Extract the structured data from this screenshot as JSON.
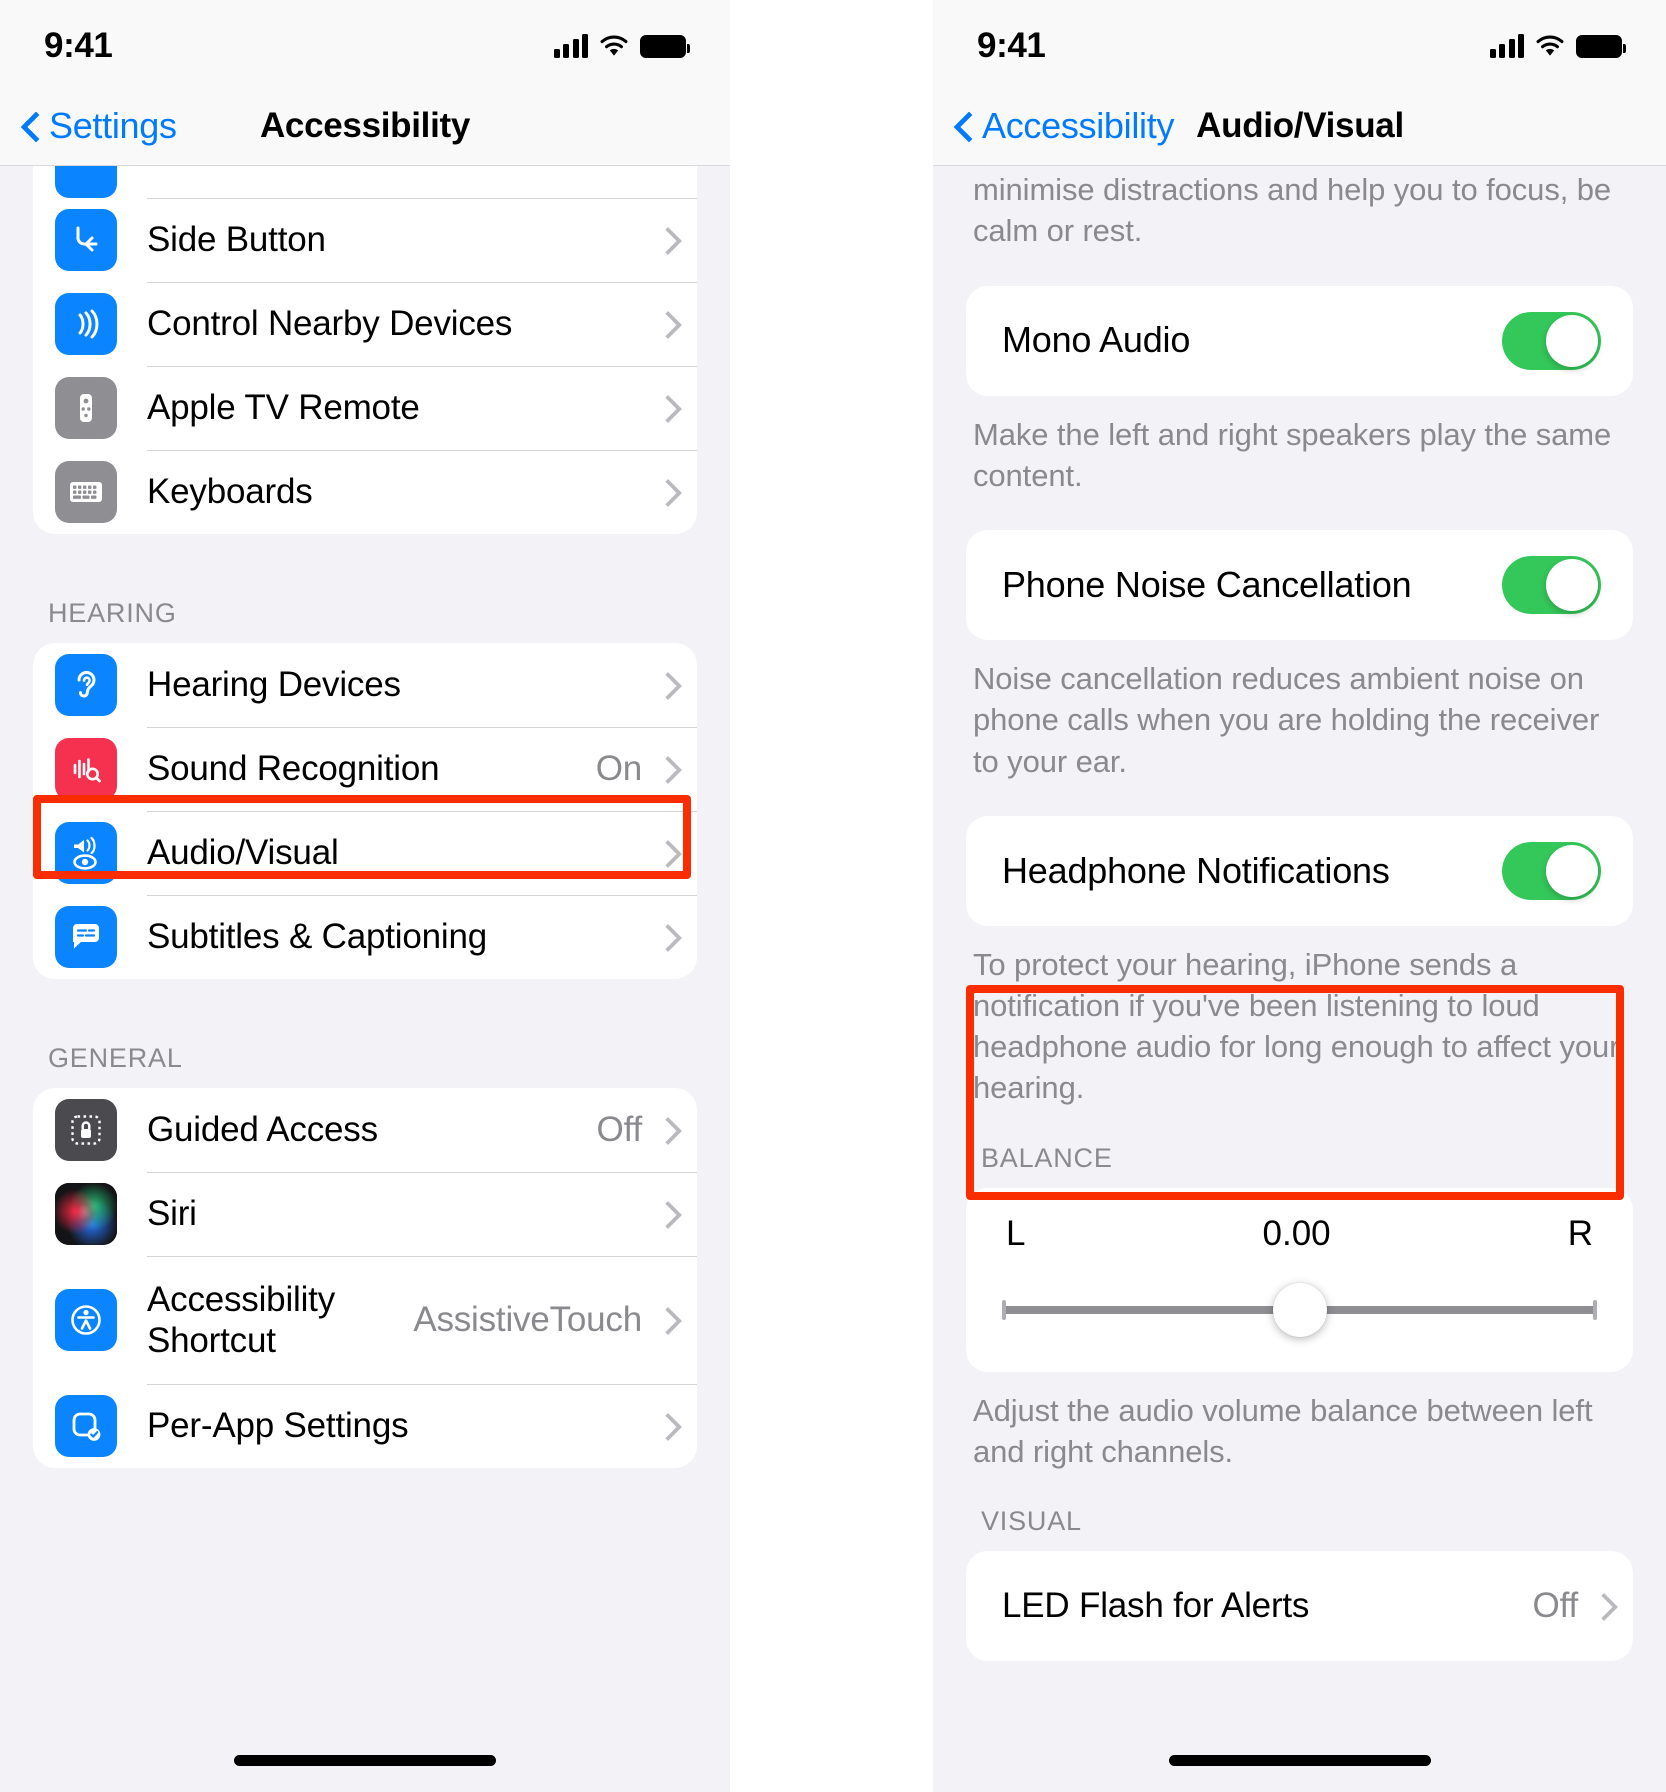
{
  "left_panel": {
    "status": {
      "time": "9:41",
      "signal_icon": "cellular-signal-icon",
      "wifi_icon": "wifi-icon",
      "battery_icon": "battery-full-icon"
    },
    "nav": {
      "back_label": "Settings",
      "title": "Accessibility",
      "back_icon": "chevron-left-icon"
    },
    "group_top": {
      "rows": [
        {
          "label": "Side Button",
          "value": "",
          "icon": "side-button-icon",
          "icon_color": "#0a84ff"
        },
        {
          "label": "Control Nearby Devices",
          "value": "",
          "icon": "control-nearby-devices-icon",
          "icon_color": "#0a84ff"
        },
        {
          "label": "Apple TV Remote",
          "value": "",
          "icon": "apple-tv-remote-icon",
          "icon_color": "#8e8e93"
        },
        {
          "label": "Keyboards",
          "value": "",
          "icon": "keyboard-icon",
          "icon_color": "#8e8e93"
        }
      ]
    },
    "hearing": {
      "header": "HEARING",
      "rows": [
        {
          "label": "Hearing Devices",
          "value": "",
          "icon": "ear-icon",
          "icon_color": "#0a84ff"
        },
        {
          "label": "Sound Recognition",
          "value": "On",
          "icon": "sound-recognition-icon",
          "icon_color": "#f5314f"
        },
        {
          "label": "Audio/Visual",
          "value": "",
          "icon": "audio-visual-icon",
          "icon_color": "#0a84ff"
        },
        {
          "label": "Subtitles & Captioning",
          "value": "",
          "icon": "subtitles-icon",
          "icon_color": "#0a84ff"
        }
      ]
    },
    "general": {
      "header": "GENERAL",
      "rows": [
        {
          "label": "Guided Access",
          "value": "Off",
          "icon": "guided-access-lock-icon",
          "icon_color": "#4a4a4f"
        },
        {
          "label": "Siri",
          "value": "",
          "icon": "siri-orb-icon",
          "icon_color": "#1c1c1e"
        },
        {
          "label": "Accessibility Shortcut",
          "value": "AssistiveTouch",
          "icon": "accessibility-person-icon",
          "icon_color": "#0a84ff"
        },
        {
          "label": "Per-App Settings",
          "value": "",
          "icon": "per-app-settings-icon",
          "icon_color": "#0a84ff"
        }
      ]
    },
    "highlight": {
      "color": "#fa2d00",
      "target": "Audio/Visual"
    }
  },
  "right_panel": {
    "status": {
      "time": "9:41",
      "signal_icon": "cellular-signal-icon",
      "wifi_icon": "wifi-icon",
      "battery_icon": "battery-full-icon"
    },
    "nav": {
      "back_label": "Accessibility",
      "title": "Audio/Visual",
      "back_icon": "chevron-left-icon"
    },
    "clipped_footnote": "environmental noise. These sounds can minimise distractions and help you to focus, be calm or rest.",
    "settings": [
      {
        "label": "Mono Audio",
        "toggle_on": true,
        "footnote": "Make the left and right speakers play the same content."
      },
      {
        "label": "Phone Noise Cancellation",
        "toggle_on": true,
        "footnote": "Noise cancellation reduces ambient noise on phone calls when you are holding the receiver to your ear."
      },
      {
        "label": "Headphone Notifications",
        "toggle_on": true,
        "footnote": "To protect your hearing, iPhone sends a notification if you've been listening to loud headphone audio for long enough to affect your hearing."
      }
    ],
    "balance": {
      "header": "BALANCE",
      "left_label": "L",
      "value": "0.00",
      "right_label": "R",
      "slider_percent": 50,
      "footnote": "Adjust the audio volume balance between left and right channels."
    },
    "visual": {
      "header": "VISUAL",
      "rows": [
        {
          "label": "LED Flash for Alerts",
          "value": "Off"
        }
      ]
    },
    "highlight": {
      "color": "#fa2d00",
      "target": "BALANCE"
    }
  },
  "colors": {
    "accent_blue": "#007aff",
    "toggle_green": "#34c759",
    "highlight_red": "#fa2d00",
    "bg_grouped": "#f2f2f7",
    "secondary_text": "#8a8a8e"
  }
}
